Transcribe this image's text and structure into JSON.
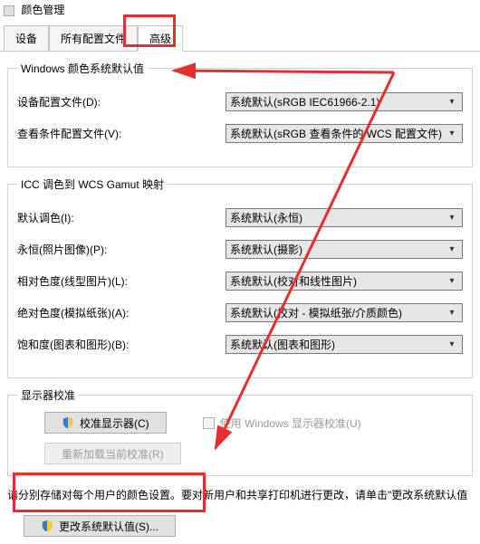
{
  "window": {
    "title": "颜色管理"
  },
  "tabs": {
    "items": [
      {
        "label": "设备"
      },
      {
        "label": "所有配置文件"
      },
      {
        "label": "高级"
      }
    ],
    "active_index": 2
  },
  "group_defaults": {
    "legend": "Windows 颜色系统默认值",
    "device_profile_label": "设备配置文件(D):",
    "device_profile_value": "系统默认(sRGB IEC61966-2.1)",
    "viewing_profile_label": "查看条件配置文件(V):",
    "viewing_profile_value": "系统默认(sRGB 查看条件的 WCS 配置文件)"
  },
  "group_icc": {
    "legend": "ICC 调色到 WCS Gamut 映射",
    "default_intent_label": "默认调色(I):",
    "default_intent_value": "系统默认(永恒)",
    "perceptual_label": "永恒(照片图像)(P):",
    "perceptual_value": "系统默认(摄影)",
    "relcol_label": "相对色度(线型图片)(L):",
    "relcol_value": "系统默认(校对和线性图片)",
    "abscol_label": "绝对色度(模拟纸张)(A):",
    "abscol_value": "系统默认(校对 - 模拟纸张/介质颜色)",
    "saturation_label": "饱和度(图表和图形)(B):",
    "saturation_value": "系统默认(图表和图形)"
  },
  "group_calibration": {
    "legend": "显示器校准",
    "calibrate_btn": "校准显示器(C)",
    "use_windows_calibration_label": "使用 Windows 显示器校准(U)",
    "reload_btn": "重新加载当前校准(R)"
  },
  "footer": {
    "note": "请分别存储对每个用户的颜色设置。要对新用户和共享打印机进行更改，请单击\"更改系统默认值",
    "change_defaults_btn": "更改系统默认值(S)..."
  }
}
